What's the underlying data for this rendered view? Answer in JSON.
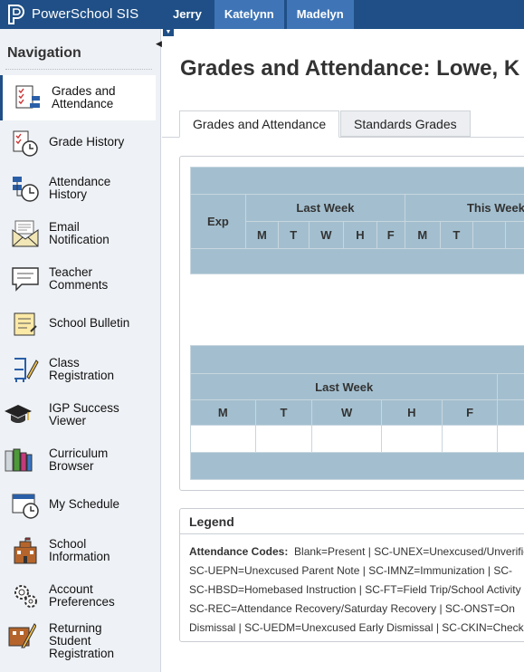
{
  "app": {
    "brand": "PowerSchool SIS"
  },
  "students": [
    {
      "label": "Jerry",
      "selected": false
    },
    {
      "label": "Katelynn",
      "selected": true
    },
    {
      "label": "Madelyn",
      "selected": false
    }
  ],
  "sidebar": {
    "title": "Navigation",
    "items": [
      {
        "line1": "Grades and",
        "line2": "Attendance",
        "icon": "grades-attendance-icon",
        "selected": true
      },
      {
        "line1": "Grade History",
        "line2": "",
        "icon": "grade-history-icon"
      },
      {
        "line1": "Attendance",
        "line2": "History",
        "icon": "attendance-history-icon"
      },
      {
        "line1": "Email",
        "line2": "Notification",
        "icon": "email-icon"
      },
      {
        "line1": "Teacher",
        "line2": "Comments",
        "icon": "comments-icon"
      },
      {
        "line1": "School Bulletin",
        "line2": "",
        "icon": "bulletin-icon"
      },
      {
        "line1": "Class",
        "line2": "Registration",
        "icon": "class-registration-icon"
      },
      {
        "line1": "IGP Success",
        "line2": "Viewer",
        "icon": "graduation-cap-icon"
      },
      {
        "line1": "Curriculum",
        "line2": "Browser",
        "icon": "books-icon"
      },
      {
        "line1": "My Schedule",
        "line2": "",
        "icon": "schedule-icon"
      },
      {
        "line1": "School",
        "line2": "Information",
        "icon": "school-icon"
      },
      {
        "line1": "Account",
        "line2": "Preferences",
        "icon": "preferences-icon"
      },
      {
        "line1": "Returning",
        "line2": "Student",
        "line3": "Registration",
        "icon": "returning-registration-icon"
      }
    ]
  },
  "page": {
    "title": "Grades and Attendance: Lowe, K",
    "tabs": [
      {
        "label": "Grades and Attendance",
        "selected": true
      },
      {
        "label": "Standards Grades",
        "selected": false
      }
    ]
  },
  "table1": {
    "exp_header": "Exp",
    "last_week": "Last Week",
    "this_week": "This Week",
    "days": [
      "M",
      "T",
      "W",
      "H",
      "F"
    ]
  },
  "table2": {
    "last_week": "Last Week",
    "days": [
      "M",
      "T",
      "W",
      "H",
      "F"
    ]
  },
  "legend": {
    "title": "Legend",
    "label": "Attendance Codes:",
    "lines": [
      "Blank=Present | SC-UNEX=Unexcused/Unverified",
      "SC-UEPN=Unexcused Parent Note | SC-IMNZ=Immunization | SC-",
      "SC-HBSD=Homebased Instruction | SC-FT=Field Trip/School Activity",
      "SC-REC=Attendance Recovery/Saturday Recovery | SC-ONST=On",
      "Dismissal | SC-UEDM=Unexcused Early Dismissal | SC-CKIN=Check In"
    ]
  }
}
